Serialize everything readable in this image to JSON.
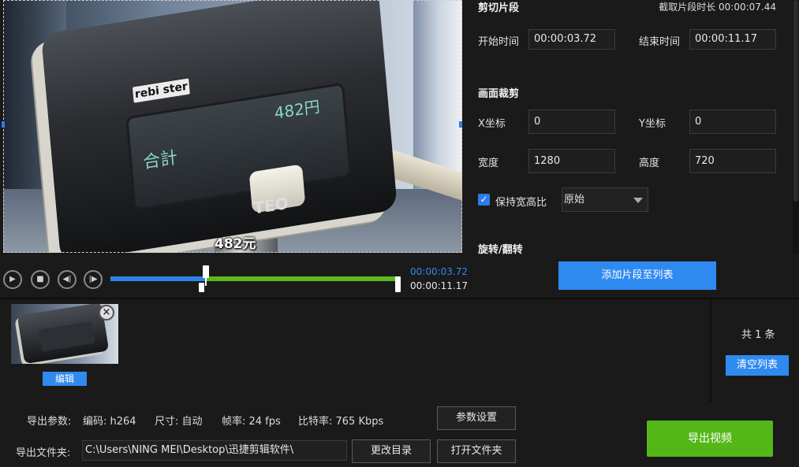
{
  "preview": {
    "device_brand": "rebi ster",
    "device_screen_price": "482円",
    "device_screen_total": "合計",
    "device_logo": "TEO",
    "subtitle": "482元"
  },
  "clip_panel": {
    "title": "剪切片段",
    "duration_label": "截取片段时长 00:00:07.44",
    "start_label": "开始时间",
    "start_value": "00:00:03.72",
    "end_label": "结束时间",
    "end_value": "00:00:11.17",
    "crop_title": "画面裁剪",
    "x_label": "X坐标",
    "x_value": "0",
    "y_label": "Y坐标",
    "y_value": "0",
    "width_label": "宽度",
    "width_value": "1280",
    "height_label": "高度",
    "height_value": "720",
    "keep_ratio_label": "保持宽高比",
    "keep_ratio_checked": true,
    "ratio_option": "原始",
    "rotate_title": "旋转/翻转"
  },
  "playback": {
    "current_time": "00:00:03.72",
    "end_time": "00:00:11.17",
    "add_button": "添加片段至列表",
    "icons": [
      "play-icon",
      "stop-icon",
      "prev-frame-icon",
      "next-frame-icon"
    ],
    "accent_color": "#2f8af0",
    "selection_color": "#5db81e"
  },
  "clip_list": {
    "edit_button": "编辑",
    "close_icon": "×",
    "count_label": "共 1 条",
    "clear_button": "清空列表"
  },
  "export": {
    "params_label": "导出参数:",
    "codec": "编码: h264",
    "size": "尺寸: 自动",
    "fps": "帧率: 24 fps",
    "bitrate": "比特率: 765 Kbps",
    "settings_button": "参数设置",
    "folder_label": "导出文件夹:",
    "folder_path": "C:\\Users\\NING MEI\\Desktop\\迅捷剪辑软件\\",
    "change_dir_button": "更改目录",
    "open_folder_button": "打开文件夹",
    "export_button": "导出视频",
    "export_color": "#53b817"
  }
}
